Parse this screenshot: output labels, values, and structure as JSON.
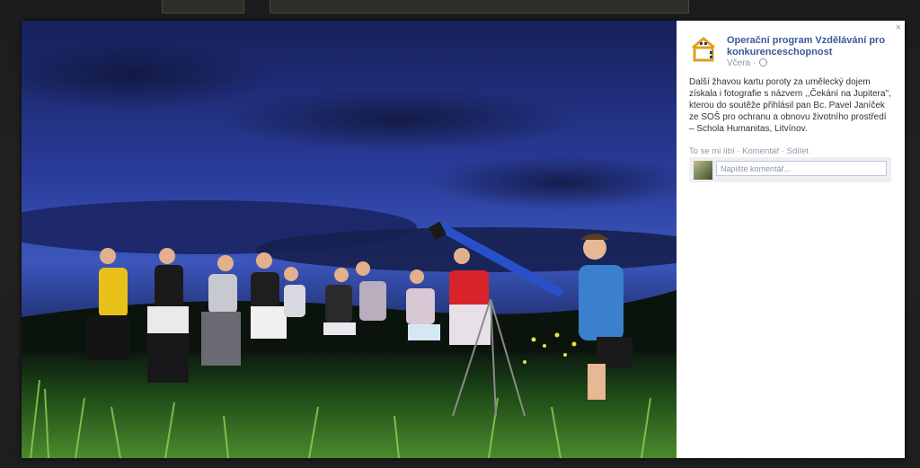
{
  "post": {
    "page_name": "Operační program Vzdělávání pro konkurenceschopnost",
    "time": "Včera",
    "separator": "·",
    "caption": "Další žhavou kartu poroty za umělecký dojem získala i fotografie s názvem ,,Čekání na Jupitera\", kterou do soutěže přihlásil pan Bc. Pavel Janíček ze SOŠ pro ochranu a obnovu životního prostředí – Schola Humanitas, Litvínov."
  },
  "actions": {
    "like": "To se mi líbí",
    "comment": "Komentář",
    "share": "Sdílet",
    "sep": " · "
  },
  "comment": {
    "placeholder": "Napište komentář..."
  },
  "close_glyph": "×",
  "colors": {
    "link": "#3b5998",
    "meta": "#9197a3",
    "sky_top": "#1a2a6c",
    "sky_bottom": "#3a52b8",
    "grass": "#2c5a1e"
  }
}
